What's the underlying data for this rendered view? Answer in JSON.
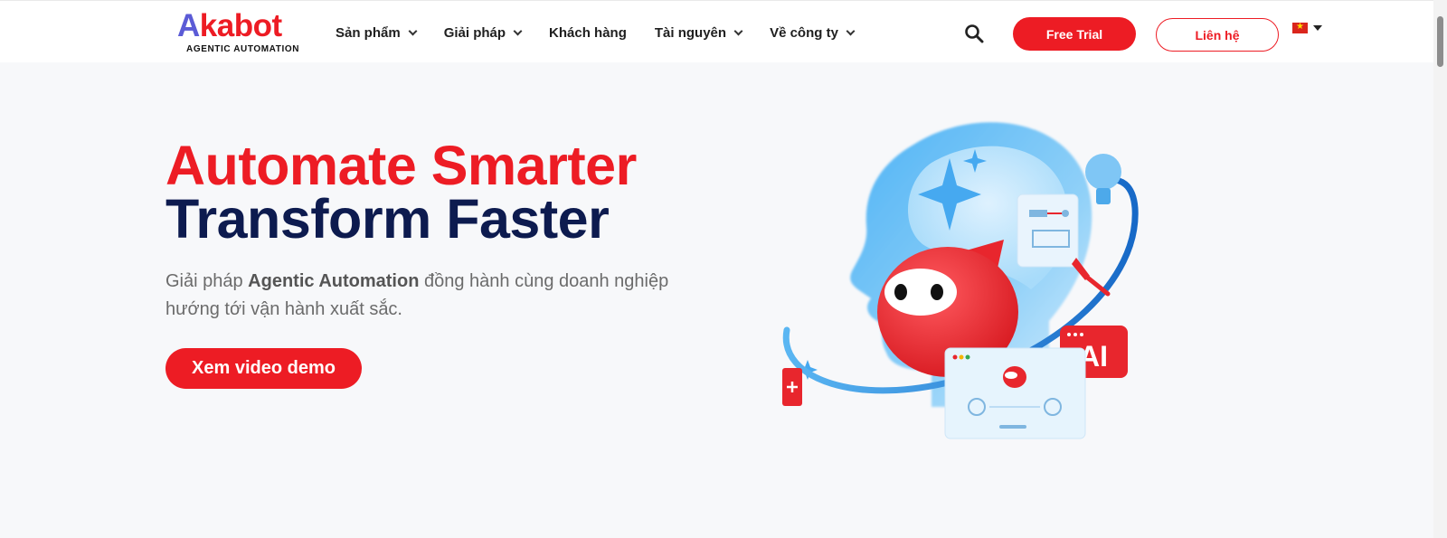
{
  "brand": {
    "logo_prefix": "A",
    "logo_rest": "kabot",
    "tagline": "AGENTIC AUTOMATION",
    "primary_color": "#ed1c24",
    "navy_color": "#0d1b4f"
  },
  "nav": {
    "items": [
      {
        "label": "Sản phẩm",
        "has_dropdown": true
      },
      {
        "label": "Giải pháp",
        "has_dropdown": true
      },
      {
        "label": "Khách hàng",
        "has_dropdown": false
      },
      {
        "label": "Tài nguyên",
        "has_dropdown": true
      },
      {
        "label": "Về công ty",
        "has_dropdown": true
      }
    ],
    "search_icon": "search-icon"
  },
  "actions": {
    "free_trial": "Free Trial",
    "contact": "Liên hệ",
    "language_icon": "vietnam-flag-icon"
  },
  "hero": {
    "headline_line1": "Automate Smarter",
    "headline_line2": "Transform Faster",
    "subtitle_start": "Giải pháp ",
    "subtitle_bold": "Agentic Automation",
    "subtitle_end": " đồng hành cùng doanh nghiệp hướng tới vận hành xuất sắc.",
    "cta": "Xem video demo",
    "illustration": {
      "ai_badge": "AI",
      "icons": [
        "ai-head-illustration",
        "robot-mascot-icon",
        "lightbulb-icon",
        "document-icon",
        "ai-badge-icon",
        "app-window-icon"
      ]
    }
  }
}
